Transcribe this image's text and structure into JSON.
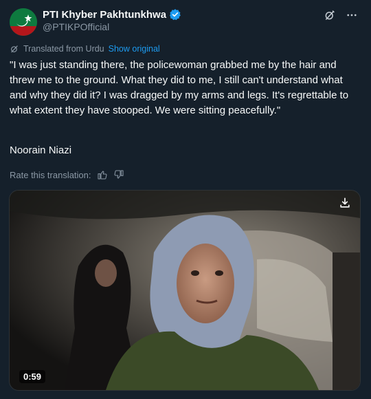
{
  "account": {
    "display_name": "PTI Khyber Pakhtunkhwa",
    "handle": "@PTIKPOfficial",
    "avatar_icon": "pti-logo-avatar",
    "verified_icon": "verified-badge-icon",
    "verified_color": "#1d9bf0"
  },
  "actions": {
    "grok_icon": "grok-icon",
    "more_icon": "more-options-icon"
  },
  "translation": {
    "label": "Translated from Urdu",
    "show_original": "Show original",
    "icon": "translate-icon"
  },
  "tweet": {
    "text": "\"I was just standing there, the policewoman grabbed me by the hair and threw me to the ground. What they did to me, I still can't understand what and why they did it? I was dragged by my arms and legs. It's regrettable to what extent they have stooped. We were sitting peacefully.\"",
    "author": "Noorain Niazi"
  },
  "rate": {
    "label": "Rate this translation:",
    "thumbs_up_icon": "thumbs-up-icon",
    "thumbs_down_icon": "thumbs-down-icon"
  },
  "media": {
    "duration": "0:59",
    "download_icon": "download-icon"
  },
  "colors": {
    "background": "#15202b",
    "text": "#f7f9f9",
    "secondary": "#8b98a5",
    "accent": "#1d9bf0"
  }
}
